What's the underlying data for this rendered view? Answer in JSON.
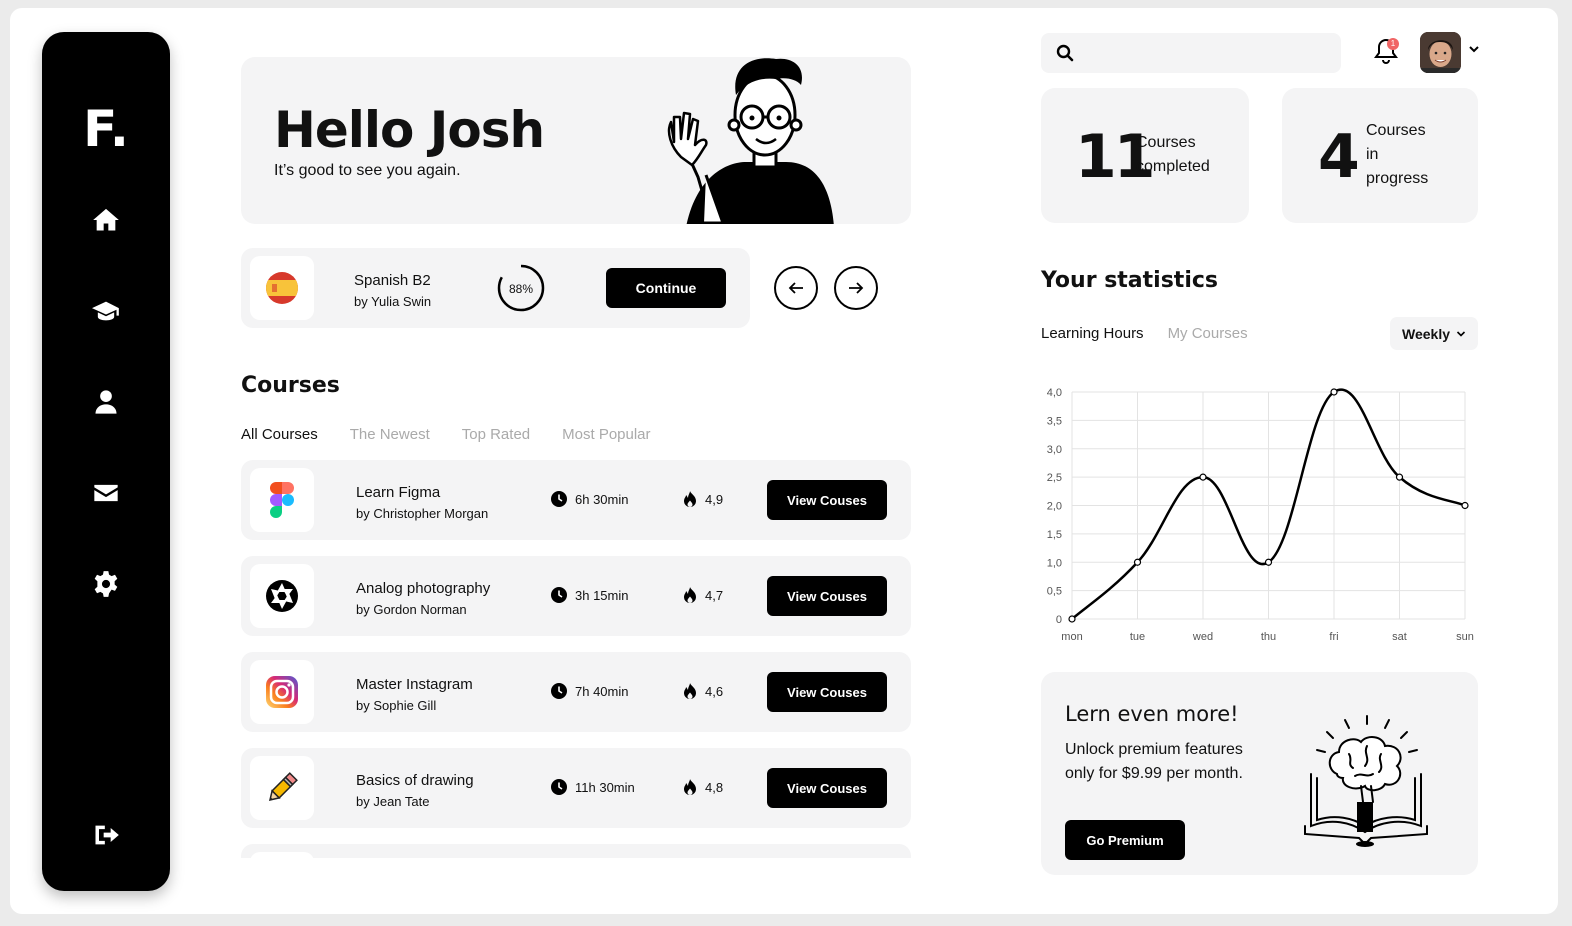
{
  "sidebar": {
    "logo": "F.",
    "items": [
      {
        "icon": "home-icon"
      },
      {
        "icon": "graduation-cap-icon"
      },
      {
        "icon": "user-icon"
      },
      {
        "icon": "mail-icon"
      },
      {
        "icon": "gear-icon"
      }
    ],
    "logout_icon": "logout-icon"
  },
  "greeting": {
    "title": "Hello Josh",
    "subtitle": "It’s good to see you again."
  },
  "current_course": {
    "title": "Spanish B2",
    "author": "by Yulia Swin",
    "progress": 0.88,
    "progress_label": "88%",
    "continue_label": "Continue"
  },
  "courses": {
    "title": "Courses",
    "tabs": [
      "All Courses",
      "The Newest",
      "Top Rated",
      "Most Popular"
    ],
    "active_tab": "All Courses",
    "items": [
      {
        "title": "Learn Figma",
        "author": "by Christopher Morgan",
        "duration": "6h 30min",
        "rating": "4,9",
        "button": "View Couses",
        "icon": "figma-icon"
      },
      {
        "title": "Analog photography",
        "author": "by Gordon Norman",
        "duration": "3h 15min",
        "rating": "4,7",
        "button": "View Couses",
        "icon": "aperture-icon"
      },
      {
        "title": "Master Instagram",
        "author": "by Sophie Gill",
        "duration": "7h 40min",
        "rating": "4,6",
        "button": "View Couses",
        "icon": "instagram-icon"
      },
      {
        "title": "Basics of drawing",
        "author": "by Jean Tate",
        "duration": "11h 30min",
        "rating": "4,8",
        "button": "View Couses",
        "icon": "pencil-icon"
      }
    ]
  },
  "header": {
    "search_placeholder": "",
    "notification_count": "1"
  },
  "summary": {
    "completed": {
      "value": "11",
      "label_line1": "Courses",
      "label_line2": "completed"
    },
    "in_progress": {
      "value": "4",
      "label_line1": "Courses",
      "label_line2": "in",
      "label_line3": "progress"
    }
  },
  "statistics": {
    "title": "Your statistics",
    "tabs": [
      "Learning Hours",
      "My Courses"
    ],
    "active_tab": "Learning Hours",
    "period": "Weekly"
  },
  "chart_data": {
    "type": "line",
    "categories": [
      "mon",
      "tue",
      "wed",
      "thu",
      "fri",
      "sat",
      "sun"
    ],
    "values": [
      0,
      1.0,
      2.5,
      1.0,
      4.0,
      2.5,
      2.0
    ],
    "yticks": [
      "0",
      "0,5",
      "1,0",
      "1,5",
      "2,0",
      "2,5",
      "3,0",
      "3,5",
      "4,0"
    ],
    "ylim": [
      0,
      4
    ],
    "grid": true,
    "title": "",
    "xlabel": "",
    "ylabel": ""
  },
  "promo": {
    "title": "Lern even more!",
    "text": "Unlock premium features only for $9.99 per month.",
    "button": "Go Premium"
  }
}
